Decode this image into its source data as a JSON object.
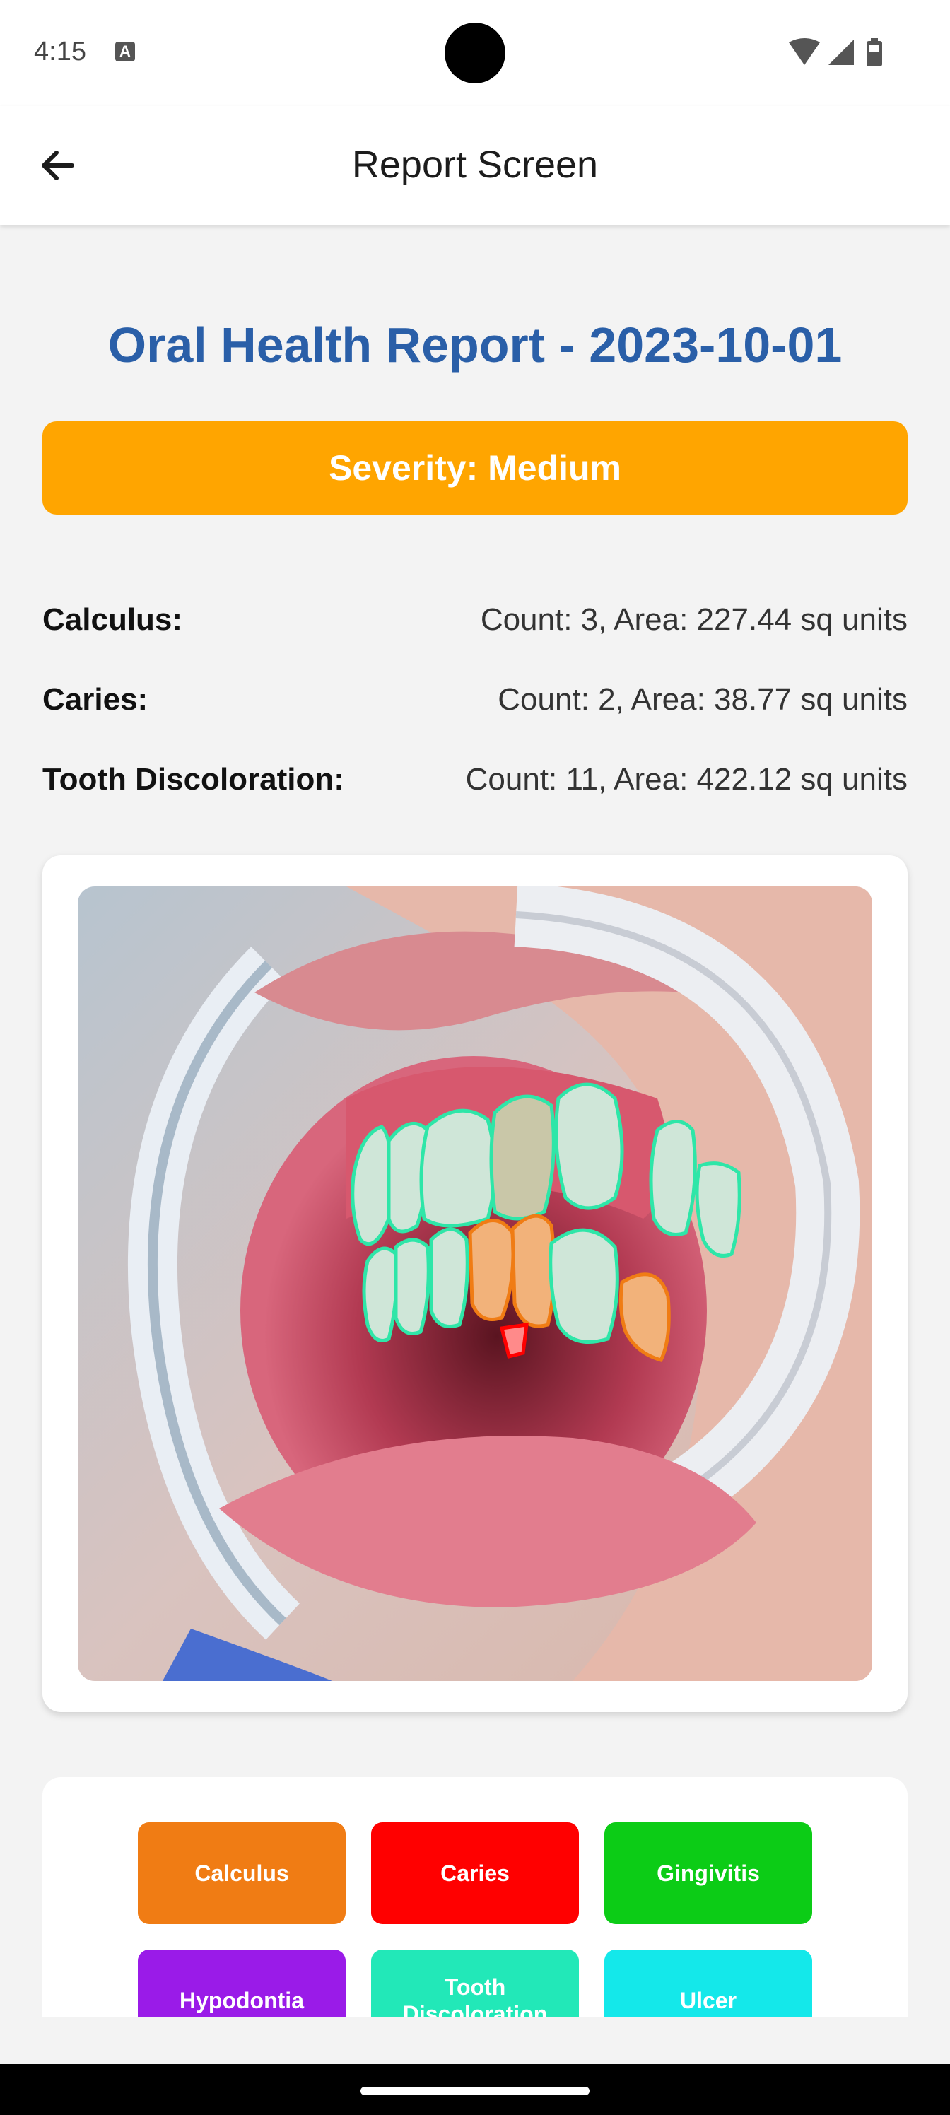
{
  "status_bar": {
    "time": "4:15",
    "notification_icon": "A"
  },
  "app_bar": {
    "title": "Report Screen",
    "back_icon": "arrow-left-icon"
  },
  "report": {
    "title": "Oral Health Report - 2023-10-01",
    "severity": "Severity: Medium",
    "severity_color": "#ffa500",
    "stats": [
      {
        "label": "Calculus:",
        "value": "Count: 3, Area: 227.44 sq units"
      },
      {
        "label": "Caries:",
        "value": "Count: 2, Area: 38.77 sq units"
      },
      {
        "label": "Tooth Discoloration:",
        "value": "Count: 11, Area: 422.12 sq units"
      }
    ]
  },
  "legend": [
    {
      "label": "Calculus",
      "color": "#f07c14"
    },
    {
      "label": "Caries",
      "color": "#ff0000"
    },
    {
      "label": "Gingivitis",
      "color": "#0ccc16"
    },
    {
      "label": "Hypodontia",
      "color": "#9a1be8"
    },
    {
      "label": "Tooth Discoloration",
      "color": "#22e8b8"
    },
    {
      "label": "Ulcer",
      "color": "#14e8ea"
    }
  ]
}
